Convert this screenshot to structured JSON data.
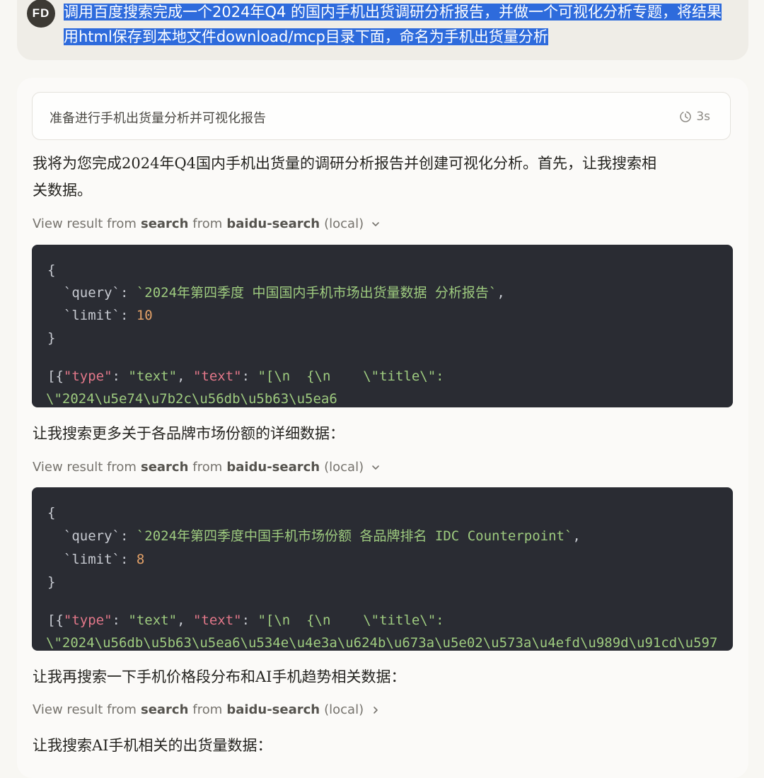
{
  "user": {
    "avatar_initials": "FD",
    "message_line1": "调用百度搜索完成一个2024年Q4 的国内手机出货调研分析报告，并做一个可视化分析专题，将结果",
    "message_line2": "用html保存到本地文件download/mcp目录下面，命名为手机出货量分析"
  },
  "thinking": {
    "label": "准备进行手机出货量分析并可视化报告",
    "duration": "3s"
  },
  "intro_text_line1": "我将为您完成2024年Q4国内手机出货量的调研分析报告并创建可视化分析。首先，让我搜索相",
  "intro_text_line2": "关数据。",
  "tool_calls": [
    {
      "prefix": "View result from",
      "tool": "search",
      "mid": "from",
      "server": "baidu-search",
      "suffix": "(local)",
      "expanded": true,
      "open": "{",
      "query_key": "`query`",
      "query_value": "`2024年第四季度 中国国内手机市场出货量数据 分析报告`",
      "limit_key": "`limit`",
      "limit_value": "10",
      "close": "}",
      "result_prefix": "[{",
      "result_type_key": "\"type\"",
      "result_type_value": "\"text\"",
      "result_text_key": "\"text\"",
      "result_text_value": "\"[\\n  {\\n    \\\"title\\\":",
      "result_line2": "\\\"2024\\u5e74\\u7b2c\\u56db\\u5b63\\u5ea6"
    },
    {
      "prefix": "View result from",
      "tool": "search",
      "mid": "from",
      "server": "baidu-search",
      "suffix": "(local)",
      "expanded": true,
      "open": "{",
      "query_key": "`query`",
      "query_value": "`2024年第四季度中国手机市场份额 各品牌排名 IDC Counterpoint`",
      "limit_key": "`limit`",
      "limit_value": "8",
      "close": "}",
      "result_prefix": "[{",
      "result_type_key": "\"type\"",
      "result_type_value": "\"text\"",
      "result_text_key": "\"text\"",
      "result_text_value": "\"[\\n  {\\n    \\\"title\\\":",
      "result_line2": "\\\"2024\\u56db\\u5b63\\u5ea6\\u534e\\u4e3a\\u624b\\u673a\\u5e02\\u573a\\u4efd\\u989d\\u91cd\\u597"
    },
    {
      "prefix": "View result from",
      "tool": "search",
      "mid": "from",
      "server": "baidu-search",
      "suffix": "(local)",
      "expanded": false
    }
  ],
  "text_after_call1": "让我搜索更多关于各品牌市场份额的详细数据：",
  "text_after_call2": "让我再搜索一下手机价格段分布和AI手机趋势相关数据：",
  "text_after_call3": "让我搜索AI手机相关的出货量数据："
}
